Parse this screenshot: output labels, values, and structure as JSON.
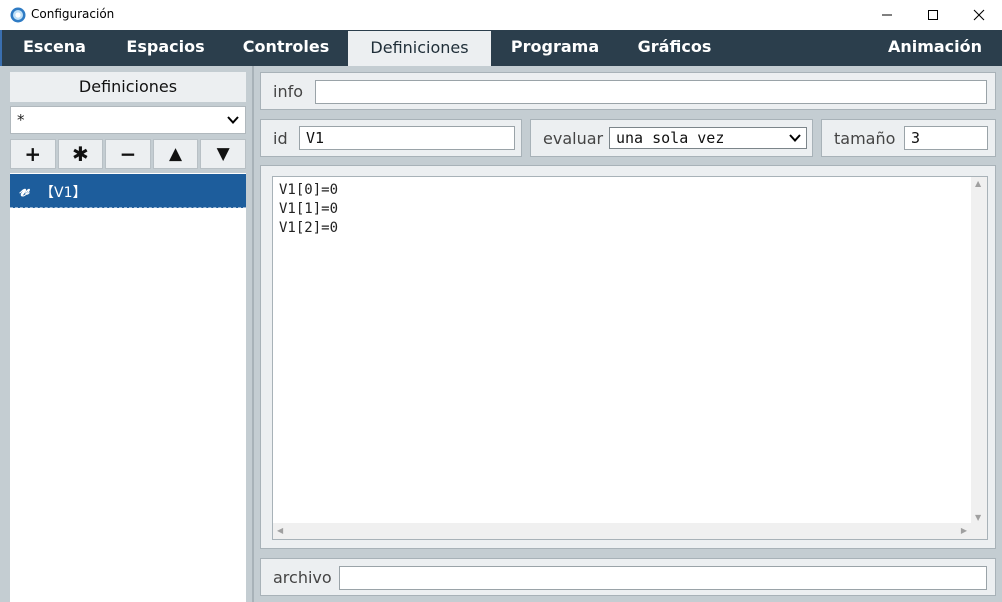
{
  "window": {
    "title": "Configuración",
    "minimize_icon": "minimize-icon",
    "maximize_icon": "maximize-icon",
    "close_icon": "close-icon"
  },
  "tabs": [
    {
      "label": "Escena",
      "active": false
    },
    {
      "label": "Espacios",
      "active": false
    },
    {
      "label": "Controles",
      "active": false
    },
    {
      "label": "Definiciones",
      "active": true
    },
    {
      "label": "Programa",
      "active": false
    },
    {
      "label": "Gráficos",
      "active": false
    },
    {
      "label": "Animación",
      "active": false
    }
  ],
  "sidebar": {
    "header": "Definiciones",
    "filter_value": "*",
    "buttons": [
      {
        "label": "+",
        "icon": "add-icon"
      },
      {
        "label": "✱",
        "icon": "asterisk-icon"
      },
      {
        "label": "−",
        "icon": "remove-icon"
      },
      {
        "label": "▲",
        "icon": "move-up-icon"
      },
      {
        "label": "▼",
        "icon": "move-down-icon"
      }
    ],
    "items": [
      {
        "icon_glyph": "𝓋",
        "label": "【V1】",
        "selected": true
      }
    ]
  },
  "form": {
    "info_label": "info",
    "info_value": "",
    "id_label": "id",
    "id_value": "V1",
    "evaluate_label": "evaluar",
    "evaluate_value": "una sola vez",
    "size_label": "tamaño",
    "size_value": "3",
    "expression_lines": [
      "V1[0]=0",
      "V1[1]=0",
      "V1[2]=0"
    ],
    "file_label": "archivo",
    "file_value": ""
  },
  "colors": {
    "tabbar_bg": "#2b3e4c",
    "selected_item_bg": "#1d5d9c",
    "panel_bg": "#c4cdd2",
    "box_bg": "#eceff1"
  }
}
